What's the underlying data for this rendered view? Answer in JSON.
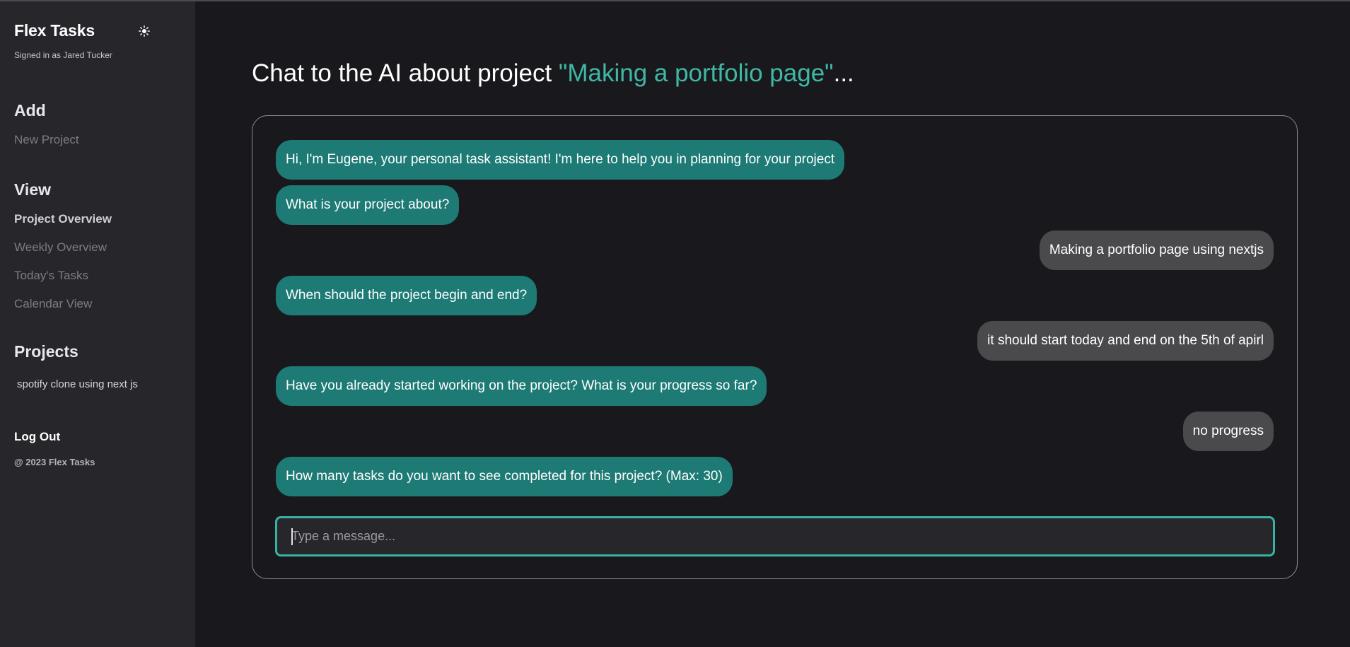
{
  "sidebar": {
    "brand": "Flex Tasks",
    "theme_icon": "sun-icon",
    "signed_in": "Signed in as Jared Tucker",
    "add": {
      "title": "Add",
      "items": [
        {
          "label": "New Project"
        }
      ]
    },
    "view": {
      "title": "View",
      "items": [
        {
          "label": "Project Overview",
          "active": true
        },
        {
          "label": "Weekly Overview",
          "active": false
        },
        {
          "label": "Today's Tasks",
          "active": false
        },
        {
          "label": "Calendar View",
          "active": false
        }
      ]
    },
    "projects": {
      "title": "Projects",
      "items": [
        {
          "label": "spotify clone using next js"
        }
      ]
    },
    "logout": "Log Out",
    "copyright": "@ 2023 Flex Tasks"
  },
  "main": {
    "title_prefix": "Chat to the AI about project ",
    "title_project": "\"Making a portfolio page\"",
    "title_suffix": "...",
    "messages": [
      {
        "role": "ai",
        "text": "Hi, I'm Eugene, your personal task assistant! I'm here to help you in planning for your project"
      },
      {
        "role": "ai",
        "text": "What is your project about?"
      },
      {
        "role": "user",
        "text": "Making a portfolio page using nextjs"
      },
      {
        "role": "ai",
        "text": "When should the project begin and end?"
      },
      {
        "role": "user",
        "text": "it should start today and end on the 5th of apirl"
      },
      {
        "role": "ai",
        "text": "Have you already started working on the project? What is your progress so far?"
      },
      {
        "role": "user",
        "text": "no progress"
      },
      {
        "role": "ai",
        "text": "How many tasks do you want to see completed for this project? (Max: 30)"
      }
    ],
    "input": {
      "placeholder": "Type a message...",
      "value": ""
    }
  },
  "colors": {
    "accent": "#3fb8a5",
    "ai_bubble": "#1d7a75",
    "user_bubble": "#4a4a4d",
    "background": "#19191d",
    "sidebar": "#26262b"
  }
}
